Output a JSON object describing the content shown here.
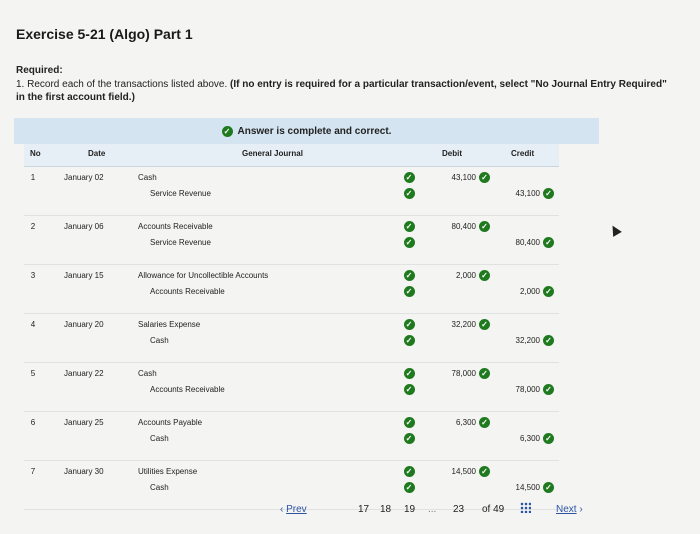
{
  "title": "Exercise 5-21 (Algo) Part 1",
  "required_heading": "Required:",
  "required_text": "1. Record each of the transactions listed above.",
  "required_bold": "(If no entry is required for a particular transaction/event, select \"No Journal Entry Required\" in the first account field.)",
  "banner": "Answer is complete and correct.",
  "headers": {
    "no": "No",
    "date": "Date",
    "journal": "General Journal",
    "debit": "Debit",
    "credit": "Credit"
  },
  "rows": [
    {
      "no": "1",
      "date": "January 02",
      "debit_account": "Cash",
      "credit_account": "Service Revenue",
      "debit": "43,100",
      "credit": "43,100"
    },
    {
      "no": "2",
      "date": "January 06",
      "debit_account": "Accounts Receivable",
      "credit_account": "Service Revenue",
      "debit": "80,400",
      "credit": "80,400"
    },
    {
      "no": "3",
      "date": "January 15",
      "debit_account": "Allowance for Uncollectible Accounts",
      "credit_account": "Accounts Receivable",
      "debit": "2,000",
      "credit": "2,000"
    },
    {
      "no": "4",
      "date": "January 20",
      "debit_account": "Salaries Expense",
      "credit_account": "Cash",
      "debit": "32,200",
      "credit": "32,200"
    },
    {
      "no": "5",
      "date": "January 22",
      "debit_account": "Cash",
      "credit_account": "Accounts Receivable",
      "debit": "78,000",
      "credit": "78,000"
    },
    {
      "no": "6",
      "date": "January 25",
      "debit_account": "Accounts Payable",
      "credit_account": "Cash",
      "debit": "6,300",
      "credit": "6,300"
    },
    {
      "no": "7",
      "date": "January 30",
      "debit_account": "Utilities Expense",
      "credit_account": "Cash",
      "debit": "14,500",
      "credit": "14,500"
    }
  ],
  "pager": {
    "prev": "Prev",
    "pages": [
      "17",
      "18",
      "19"
    ],
    "ellipsis": "...",
    "current": "23",
    "of": "of 49",
    "next": "Next"
  },
  "colors": {
    "check": "#1f7a1f",
    "banner": "#d4e4f0",
    "header": "#e7eff6"
  }
}
